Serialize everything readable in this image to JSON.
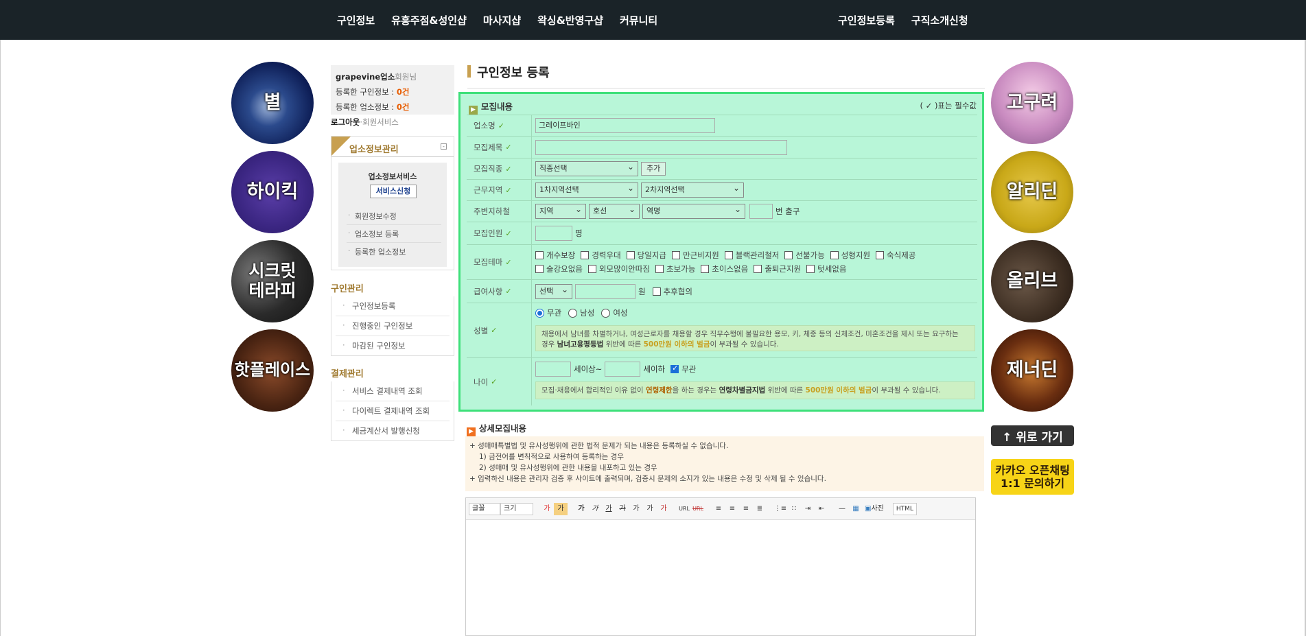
{
  "nav": {
    "left": [
      "구인정보",
      "유흥주점&성인샵",
      "마사지샵",
      "왁싱&반영구샵",
      "커뮤니티"
    ],
    "right": [
      "구인정보등록",
      "구직소개신청"
    ]
  },
  "banners_left": [
    "별",
    "하이킥",
    "시크릿\n테라피",
    "핫플레이스"
  ],
  "banners_right": [
    "고구려",
    "알리딘",
    "올리브",
    "제너딘"
  ],
  "top_button": "↑ 위로 가기",
  "kakao_button": {
    "line1": "카카오 오픈채팅",
    "line2": "1:1 문의하기"
  },
  "user": {
    "name": "grapevine",
    "type": "업소",
    "suffix": "회원님",
    "job_label": "등록한 구인정보 : ",
    "job_count": "0건",
    "org_label": "등록한 업소정보 : ",
    "org_count": "0건",
    "logout": "로그아웃",
    "member_service": "·회원서비스"
  },
  "org_panel": {
    "title": "업소정보관리",
    "toggle": "-",
    "service_title": "업소정보서비스",
    "apply_button": "서비스신청",
    "items": [
      "회원정보수정",
      "업소정보 등록",
      "등록한 업소정보"
    ]
  },
  "job_mgmt": {
    "title": "구인관리",
    "items": [
      "구인정보등록",
      "진행중인 구인정보",
      "마감된 구인정보"
    ]
  },
  "pay_mgmt": {
    "title": "결제관리",
    "items": [
      "서비스 결제내역 조회",
      "다이렉트 결제내역 조회",
      "세금계산서 발행신청"
    ]
  },
  "page_title": "구인정보 등록",
  "form": {
    "header": "모집내용",
    "required_note": "( ✓ )표는 필수값",
    "rows": {
      "org_name": {
        "label": "업소명",
        "value": "그레이프바인"
      },
      "title": {
        "label": "모집제목",
        "value": ""
      },
      "job_type": {
        "label": "모집직종",
        "select": "직종선택",
        "add": "추가"
      },
      "region": {
        "label": "근무지역",
        "sel1": "1차지역선택",
        "sel2": "2차지역선택"
      },
      "subway": {
        "label": "주변지하철",
        "sel1": "지역",
        "sel2": "호선",
        "sel3": "역명",
        "suffix": "번 출구"
      },
      "count": {
        "label": "모집인원",
        "suffix": "명"
      },
      "theme": {
        "label": "모집테마",
        "options": [
          "개수보장",
          "경력우대",
          "당일지급",
          "만근비지원",
          "블랙관리철저",
          "선불가능",
          "성형지원",
          "숙식제공",
          "술강요없음",
          "외모많이안따짐",
          "초보가능",
          "초이스없음",
          "출퇴근지원",
          "텃세없음"
        ]
      },
      "pay": {
        "label": "급여사항",
        "select": "선택",
        "unit": "원",
        "negotiable": "추후협의"
      },
      "gender": {
        "label": "성별",
        "options": [
          "무관",
          "남성",
          "여성"
        ],
        "note_a": "채용에서 남녀를 차별하거나, 여성근로자를 채용할 경우 직무수행에 불필요한 용모, 키, 체중 등의 신체조건, 미혼조건을 제시 또는 요구하는",
        "note_b": "경우 ",
        "note_law": "남녀고용평등법",
        "note_c": " 위반에 따른 ",
        "note_fine": "500만원 이하의 벌금",
        "note_d": "이 부과될 수 있습니다."
      },
      "age": {
        "label": "나이",
        "above": "세이상~",
        "below": "세이하",
        "any": "무관",
        "note_a": "모집·채용에서 합리적인 이유 없이 ",
        "note_limit": "연령제한",
        "note_b": "을 하는 경우는 ",
        "note_law": "연령차별금지법",
        "note_c": " 위반에 따른 ",
        "note_fine": "500만원 이하의 벌금",
        "note_d": "이 부과될 수 있습니다."
      }
    }
  },
  "detail": {
    "title": "상세모집내용",
    "warnings": [
      "+ 성매매특별법 및 유사성행위에 관한 법적 문제가 되는 내용은 등록하실 수 없습니다.",
      "1) 금전어를 변칙적으로 사용하여 등록하는 경우",
      "2) 성매매 및 유사성행위에 관한 내용을 내포하고 있는 경우",
      "+ 입력하신 내용은 관리자 검증 후 사이트에 출력되며, 검증시 문제의 소지가 있는 내용은 수정 및 삭제 될 수 있습니다."
    ],
    "toolbar": {
      "font": "글꼴",
      "size": "크기",
      "format": [
        "가",
        "가",
        "가",
        "가",
        "가",
        "가",
        "가",
        "가",
        "가"
      ],
      "url": [
        "URL",
        "URL"
      ],
      "photo": "사진",
      "html": "HTML"
    }
  },
  "colors": {
    "accent": "#c8a050",
    "form_bg": "#b8f6d8",
    "form_border": "#3ee07a",
    "topbar": "#1a2328"
  }
}
